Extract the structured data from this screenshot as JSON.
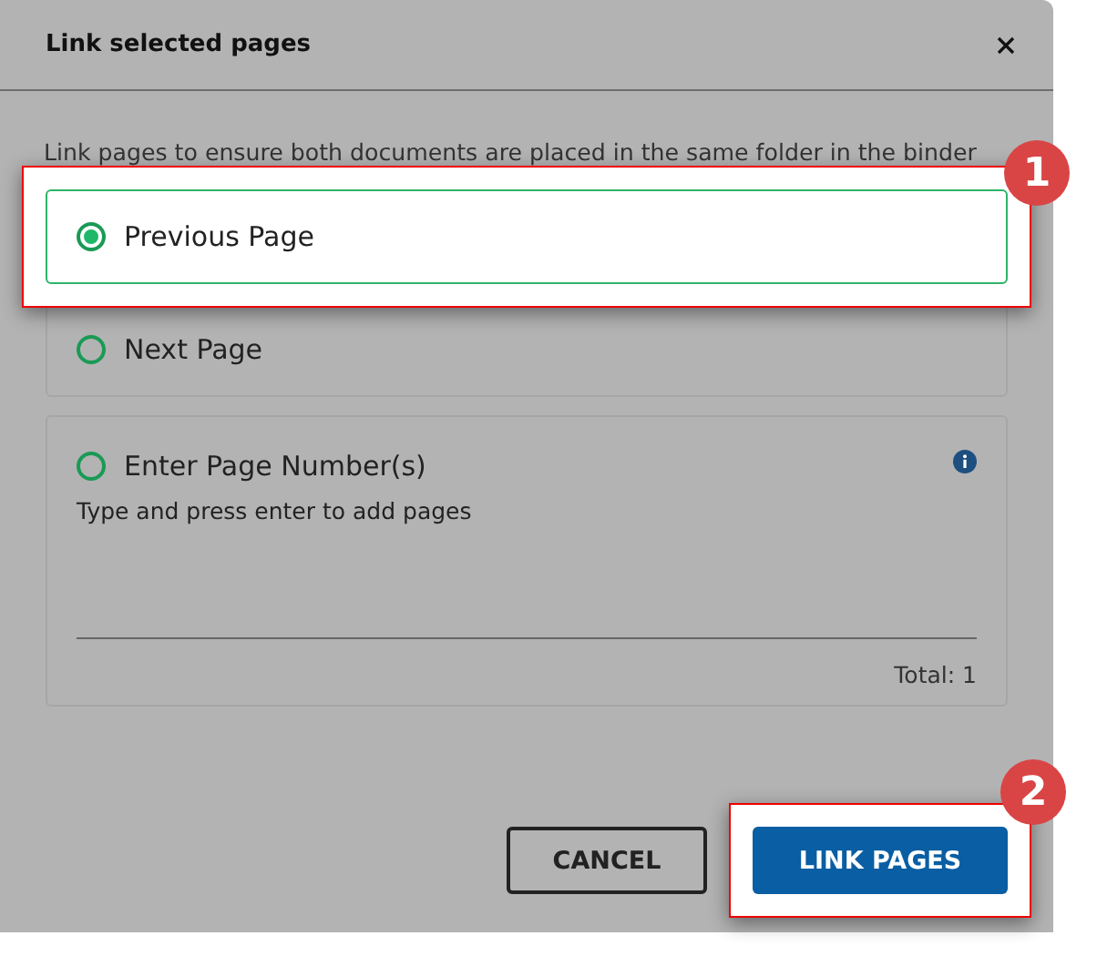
{
  "dialog": {
    "title": "Link selected pages",
    "description": "Link pages to ensure both documents are placed in the same folder in the binder"
  },
  "options": [
    {
      "kind": "simple",
      "label": "Previous Page",
      "selected": true,
      "callout": "1"
    },
    {
      "kind": "simple",
      "label": "Next Page",
      "selected": false
    },
    {
      "kind": "pages",
      "label": "Enter Page Number(s)",
      "selected": false,
      "hint": "Type and press enter to add pages",
      "total": "Total: 1"
    }
  ],
  "buttons": [
    {
      "kind": "secondary",
      "label": "CANCEL"
    },
    {
      "kind": "primary",
      "label": "LINK PAGES",
      "callout": "2"
    }
  ]
}
